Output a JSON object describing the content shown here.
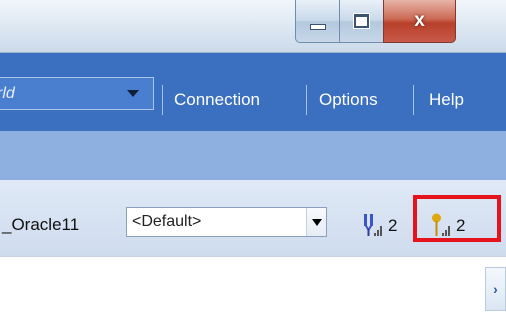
{
  "window": {
    "minimize_icon": "minimize-icon",
    "maximize_icon": "maximize-icon",
    "close_label": "x"
  },
  "menubar": {
    "database_combo": {
      "value": "rld"
    },
    "items": [
      {
        "label": "Connection"
      },
      {
        "label": "Options"
      },
      {
        "label": "Help"
      }
    ]
  },
  "status": {
    "connection_name": "_Oracle11",
    "schema_select": {
      "value": "<Default>"
    },
    "connections": [
      {
        "icon": "blue-signal-icon",
        "count": "2",
        "color": "#3a55c8"
      },
      {
        "icon": "yellow-signal-icon",
        "count": "2",
        "color": "#e0a80e"
      }
    ]
  },
  "colors": {
    "menubar": "#3b6fbf",
    "band": "#8eb0e0",
    "highlight": "#e5141c"
  }
}
